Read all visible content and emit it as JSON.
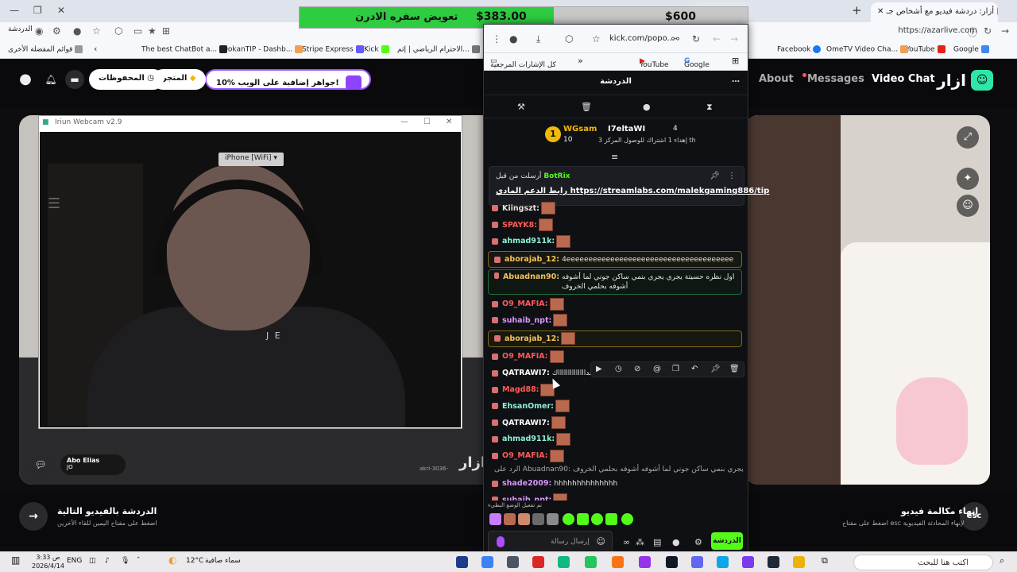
{
  "browser": {
    "tab_active": "أزار: دردشة فيديو مع أشخاص جـ",
    "tab_min_fragment": "min",
    "back_url": "https://azarlive.com",
    "profile_label": "الدردشة",
    "bookmarks": [
      "Google",
      "YouTube",
      "OmeTV Video Cha...",
      "Facebook",
      "الاحترام الرياضي | إثم...",
      "Kick",
      "Stripe Express",
      "DokanTIP - Dashb...",
      "The best ChatBot a...",
      "قوائم المفضلة الأخرى"
    ]
  },
  "banner": {
    "title": "تعويض سفره الادرن",
    "price_current": "$383.00",
    "price_goal": "$600"
  },
  "azar": {
    "logo": "ازار",
    "nav": {
      "video_chat": "Video Chat",
      "messages": "Messages",
      "about": "About"
    },
    "gift_pill": "10% جواهر إضافية على الويب!",
    "store_pill": "المتجر",
    "saved_pill": "المحفوظات",
    "peer": {
      "name": "Abo Elias",
      "country": "JO"
    },
    "watermark": "ازار",
    "watermark_small": "akri-3036-"
  },
  "iriun": {
    "title": "Iriun Webcam v2.9",
    "device": "iPhone [WiFi]",
    "shirt_text": "J E"
  },
  "bottom": {
    "next_title": "الدردشة بالفيديو التالية",
    "next_sub": "اضغط على مفتاح اليمين للقاء الآخرين",
    "end_title": "إنهاء مكالمة فيديو",
    "end_sub": "اضغط على مفتاح esc لإنهاء المحادثة الفيديوية",
    "esc_label": "esc"
  },
  "popup": {
    "url": "kick.com/popo...",
    "bookmarks": [
      "Google",
      "YouTube",
      "كل الإشارات المرجعية"
    ],
    "header_title": "الدردشة",
    "leader": {
      "rank": "1",
      "name1": "WGsam",
      "count1": "10",
      "name2": "I7eltaWI",
      "count2": "4",
      "desc": "إهداء 1 اشتراك للوصول المركز 3 th"
    },
    "pinned": {
      "sender_prefix": "أرسلت من قبل",
      "bot": "BotRix",
      "link": "https://streamlabs.com/malekgaming886/tip",
      "link_label": "رابط الدعم المادي"
    },
    "messages": [
      {
        "user": "Kiingszt:",
        "color": "#e8e4dc",
        "text": ""
      },
      {
        "user": "SPAYK8:",
        "color": "#ff5a5a",
        "text": ""
      },
      {
        "user": "ahmad911k:",
        "color": "#8ff0d6",
        "text": ""
      },
      {
        "user": "aborajab_12:",
        "color": "#f3c15a",
        "text": "4ееееееееееееееееееееееееееееееееееееее",
        "style": "hl"
      },
      {
        "user": "Abuadnan90:",
        "color": "#f3c15a",
        "text": "اول نظره حسيتة يجري يجري بنمي ساكن جوني لما أشوفه أشوفه بحلمي الخروف",
        "style": "tall"
      },
      {
        "user": "O9_MAFIA:",
        "color": "#ff5a5a",
        "text": ""
      },
      {
        "user": "suhaib_npt:",
        "color": "#d996ff",
        "text": ""
      },
      {
        "user": "aborajab_12:",
        "color": "#f3c15a",
        "text": "",
        "style": "hl"
      },
      {
        "user": "O9_MAFIA:",
        "color": "#ff5a5a",
        "text": ""
      },
      {
        "user": "QATRAWI7:",
        "color": "#ffffff",
        "text": "سعدااااااااااااااك"
      },
      {
        "user": "Magd88:",
        "color": "#ff5a5a",
        "text": ""
      },
      {
        "user": "EhsanOmer:",
        "color": "#8ff0d6",
        "text": ""
      },
      {
        "user": "QATRAWI7:",
        "color": "#ffffff",
        "text": ""
      },
      {
        "user": "ahmad911k:",
        "color": "#8ff0d6",
        "text": ""
      },
      {
        "user": "O9_MAFIA:",
        "color": "#ff5a5a",
        "text": ""
      },
      {
        "user": "",
        "color": "#aaaaaa",
        "text": "الرد على Abuadnan90: اول نظره حسيتة يجري يجري بنمي ساكن جوني لما أشوفه أشوفه بحلمي الخروف",
        "style": "reply"
      },
      {
        "user": "shade2009:",
        "color": "#d996ff",
        "text": "hhhhhhhhhhhhhh"
      },
      {
        "user": "suhaib_npt:",
        "color": "#d996ff",
        "text": ""
      }
    ],
    "mode_note": "تم تفعيل الوضع البطيء",
    "input_placeholder": "إرسال رسالة",
    "send_label": "الدردشة"
  },
  "taskbar": {
    "search_text": "اكتب هنا للبحث",
    "weather": "سماء صافية",
    "temp": "12°C",
    "lang": "ENG",
    "time": "3:33 ص",
    "date": "2026/4/14"
  }
}
